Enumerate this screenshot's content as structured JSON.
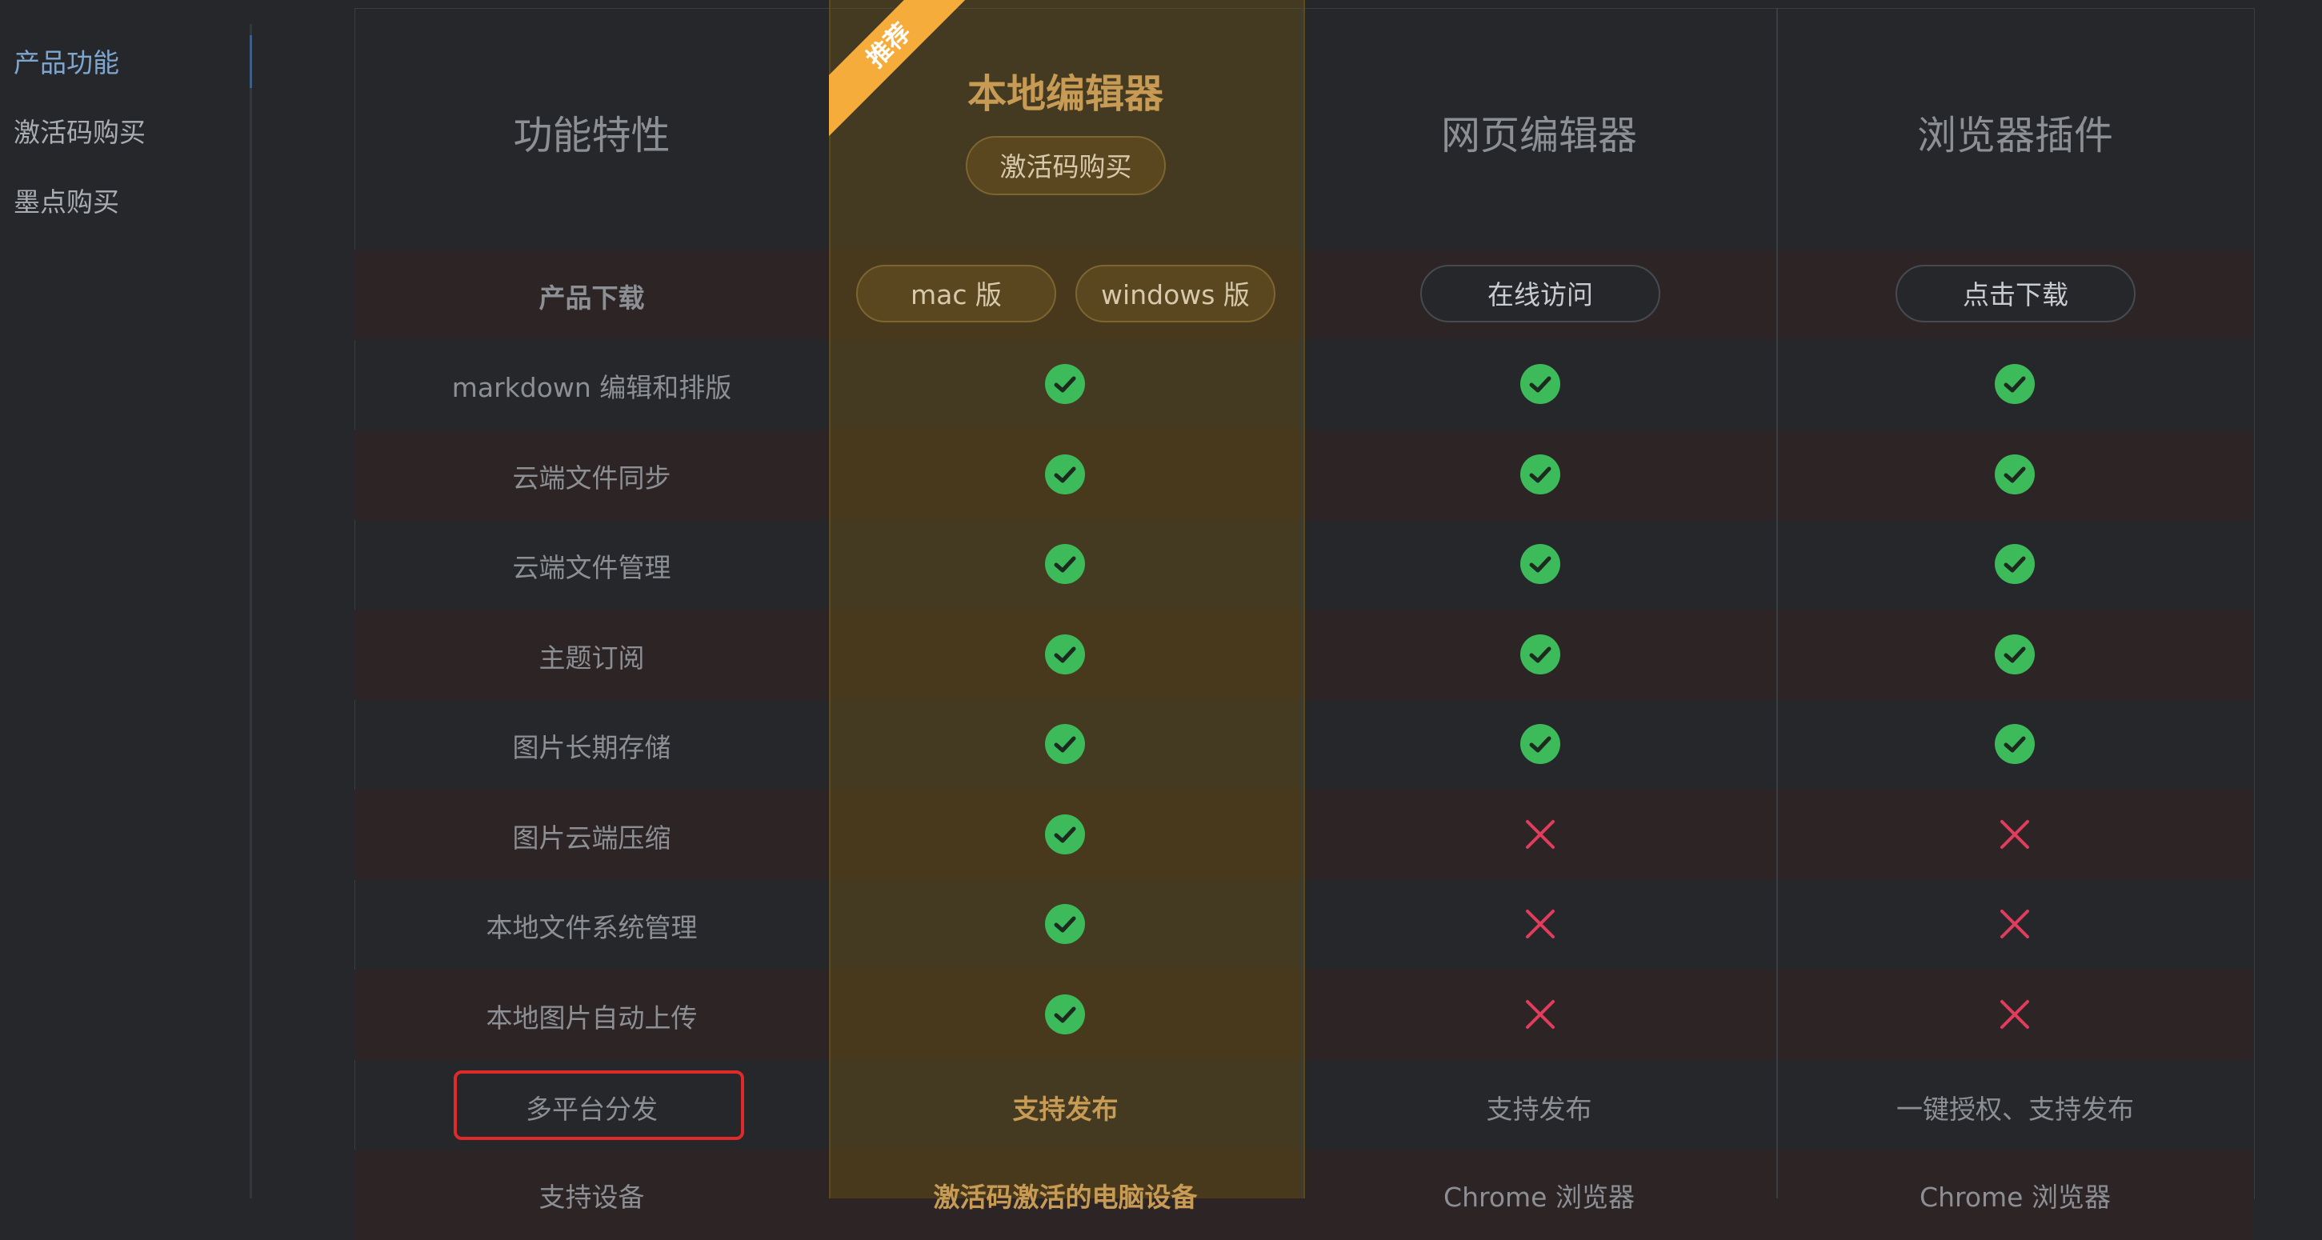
{
  "sidebar": {
    "items": [
      {
        "label": "产品功能",
        "active": true
      },
      {
        "label": "激活码购买",
        "active": false
      },
      {
        "label": "墨点购买",
        "active": false
      }
    ]
  },
  "columns": {
    "feature": {
      "title": "功能特性"
    },
    "local": {
      "title": "本地编辑器",
      "badge": "推荐",
      "buy_button": "激活码购买"
    },
    "web": {
      "title": "网页编辑器"
    },
    "plugin": {
      "title": "浏览器插件"
    }
  },
  "download_row": {
    "label": "产品下载",
    "local_mac": "mac 版",
    "local_windows": "windows 版",
    "web": "在线访问",
    "plugin": "点击下载"
  },
  "features": [
    {
      "label": "markdown 编辑和排版",
      "local": "check",
      "web": "check",
      "plugin": "check"
    },
    {
      "label": "云端文件同步",
      "local": "check",
      "web": "check",
      "plugin": "check"
    },
    {
      "label": "云端文件管理",
      "local": "check",
      "web": "check",
      "plugin": "check"
    },
    {
      "label": "主题订阅",
      "local": "check",
      "web": "check",
      "plugin": "check"
    },
    {
      "label": "图片长期存储",
      "local": "check",
      "web": "check",
      "plugin": "check"
    },
    {
      "label": "图片云端压缩",
      "local": "check",
      "web": "cross",
      "plugin": "cross"
    },
    {
      "label": "本地文件系统管理",
      "local": "check",
      "web": "cross",
      "plugin": "cross"
    },
    {
      "label": "本地图片自动上传",
      "local": "check",
      "web": "cross",
      "plugin": "cross"
    }
  ],
  "multi_platform_row": {
    "label": "多平台分发",
    "local": "支持发布",
    "web": "支持发布",
    "plugin": "一键授权、支持发布"
  },
  "devices_row": {
    "label": "支持设备",
    "local": "激活码激活的电脑设备",
    "web": "Chrome 浏览器",
    "plugin": "Chrome 浏览器"
  },
  "colors": {
    "check": "#3dbb5b",
    "cross": "#e23c5d",
    "gold": "#c89b55",
    "highlight": "#e02a2a"
  }
}
